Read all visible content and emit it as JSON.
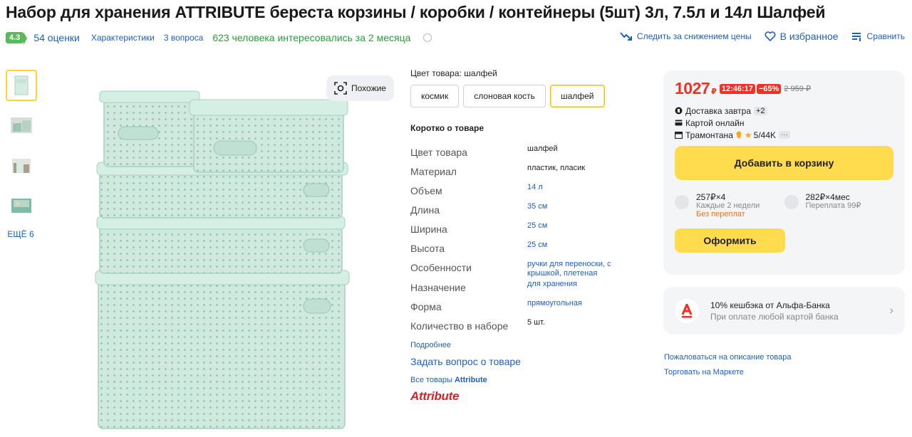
{
  "title": "Набор для хранения ATTRIBUTE береста корзины / коробки / контейнеры (5шт) 3л, 7.5л и 14л Шалфей",
  "meta": {
    "rating": "4.3",
    "reviews": "54 оценки",
    "characteristics": "Характеристики",
    "questions": "3 вопроса",
    "interest": "623 человека интересовались за 2 месяца"
  },
  "top_actions": {
    "price_watch": "Следить за снижением цены",
    "favorite": "В избранное",
    "compare": "Сравнить"
  },
  "gallery": {
    "more": "ЕЩЁ 6",
    "similar": "Похожие"
  },
  "color": {
    "label": "Цвет товара: шалфей",
    "options": [
      "космик",
      "слоновая кость",
      "шалфей"
    ],
    "selected": "шалфей"
  },
  "brief": {
    "title": "Коротко о товаре",
    "specs": [
      {
        "key": "Цвет товара",
        "value": "шалфей",
        "link": false
      },
      {
        "key": "Материал",
        "value": "пластик, пласик",
        "link": false
      },
      {
        "key": "Объем",
        "value": "14 л",
        "link": true
      },
      {
        "key": "Длина",
        "value": "35 см",
        "link": true
      },
      {
        "key": "Ширина",
        "value": "25 см",
        "link": true
      },
      {
        "key": "Высота",
        "value": "25 см",
        "link": true
      },
      {
        "key": "Особенности",
        "value": "ручки для переноски, с крышкой, плетеная",
        "link": true
      },
      {
        "key": "Назначение",
        "value": "для хранения",
        "link": true
      },
      {
        "key": "Форма",
        "value": "прямоугольная",
        "link": true
      },
      {
        "key": "Количество в наборе",
        "value": "5 шт.",
        "link": false
      }
    ],
    "more": "Подробнее",
    "ask": "Задать вопрос о товаре",
    "all_goods_prefix": "Все товары",
    "all_goods_brand": "Attribute",
    "brand_logo": "Attribute"
  },
  "buy": {
    "price": "1027",
    "currency": "₽",
    "timer": "12:46:17",
    "discount": "−65%",
    "old_price": "2 959 ₽",
    "delivery": "Доставка завтра",
    "delivery_badge": "+2",
    "payment": "Картой онлайн",
    "seller": "Трамонтана",
    "seller_rating": "5/44K",
    "seller_more": "···",
    "add_to_cart": "Добавить в корзину",
    "installments": [
      {
        "amount": "257₽×4",
        "sub": "Каждые 2 недели",
        "note": "Без переплат"
      },
      {
        "amount": "282₽×4мес",
        "sub": "Переплата 99₽",
        "note": ""
      }
    ],
    "checkout": "Оформить"
  },
  "alfa": {
    "line1": "10% кешбэка от Альфа-Банка",
    "line2": "При оплате любой картой банка"
  },
  "side_links": {
    "complain": "Пожаловаться на описание товара",
    "sell": "Торговать на Маркете"
  },
  "colors": {
    "accent_red": "#ef3124",
    "yellow": "#ffdb4d",
    "link_blue": "#1f5fbf",
    "rating_green": "#5cb85c",
    "product_mint": "#cfe9df"
  }
}
